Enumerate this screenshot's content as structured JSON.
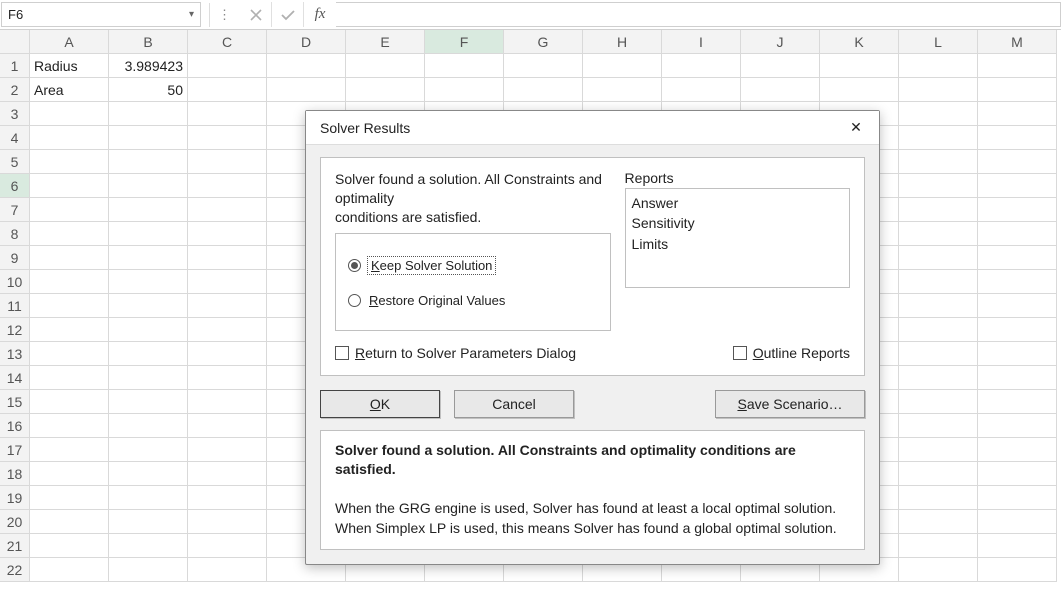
{
  "formula_bar": {
    "name_box": "F6",
    "fx_label": "fx",
    "formula_value": ""
  },
  "columns": [
    "A",
    "B",
    "C",
    "D",
    "E",
    "F",
    "G",
    "H",
    "I",
    "J",
    "K",
    "L",
    "M"
  ],
  "rows": [
    "1",
    "2",
    "3",
    "4",
    "5",
    "6",
    "7",
    "8",
    "9",
    "10",
    "11",
    "12",
    "13",
    "14",
    "15",
    "16",
    "17",
    "18",
    "19",
    "20",
    "21",
    "22"
  ],
  "cells": {
    "A1": "Radius",
    "B1": "3.989423",
    "A2": "Area",
    "B2": "50"
  },
  "selected_cell": "F6",
  "dialog": {
    "title": "Solver Results",
    "close_label": "✕",
    "message_line1": "Solver found a solution.  All Constraints and optimality",
    "message_line2": "conditions are satisfied.",
    "radio_keep_prefix": "K",
    "radio_keep_rest": "eep Solver Solution",
    "radio_restore_prefix": "R",
    "radio_restore_rest": "estore Original Values",
    "reports_label": "Reports",
    "reports": {
      "answer": "Answer",
      "sensitivity": "Sensitivity",
      "limits": "Limits"
    },
    "return_dialog_label": "Return to Solver Parameters Dialog",
    "outline_reports_prefix": "O",
    "outline_reports_rest": "utline Reports",
    "ok_prefix": "O",
    "ok_rest": "K",
    "cancel_label": "Cancel",
    "save_scenario_prefix": "S",
    "save_scenario_rest": "ave Scenario…",
    "desc_bold": "Solver found a solution.  All Constraints and optimality conditions are satisfied.",
    "desc_line1": "When the GRG engine is used, Solver has found at least a local optimal solution.",
    "desc_line2": "When Simplex LP is used, this means Solver has found a global optimal solution."
  }
}
